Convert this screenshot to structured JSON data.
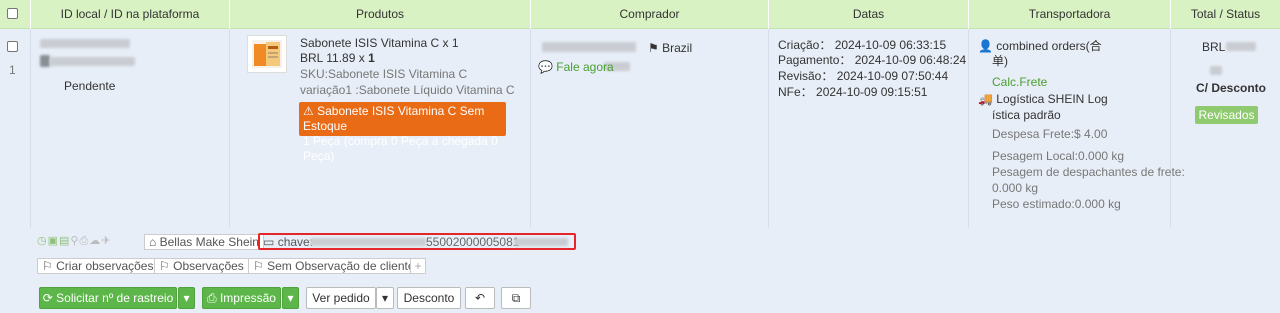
{
  "header": {
    "col_id": "ID local / ID na plataforma",
    "col_products": "Produtos",
    "col_buyer": "Comprador",
    "col_dates": "Datas",
    "col_carrier": "Transportadora",
    "col_total": "Total / Status"
  },
  "order": {
    "index": "1",
    "status": "Pendente",
    "product": {
      "title": "Sabonete ISIS Vitamina C x 1",
      "price": "BRL 11.89 x",
      "qty": "1",
      "sku": "SKU:Sabonete ISIS Vitamina C",
      "variation": "variação1 :Sabonete Líquido Vitamina C",
      "stock_warning_line1": "Sabonete ISIS Vitamina C Sem Estoque",
      "stock_warning_line2": "1 Peça (compra 0 Peça a chegada 0 Peça)"
    },
    "buyer": {
      "country": "Brazil",
      "chat": "Fale agora"
    },
    "dates": {
      "creation_label": "Criação：",
      "creation": "2024-10-09 06:33:15",
      "payment_label": "Pagamento：",
      "payment": "2024-10-09 06:48:24",
      "revision_label": "Revisão：",
      "revision": "2024-10-09 07:50:44",
      "nfe_label": "NFe：",
      "nfe": "2024-10-09 09:15:51"
    },
    "carrier": {
      "combined_line1": "combined orders(合",
      "combined_line2": "单)",
      "calc_frete": "Calc.Frete",
      "logistics_line1": "Logística SHEIN Log",
      "logistics_line2": "ística padrão",
      "despesa": "Despesa Frete:$ 4.00",
      "pesagem_local": "Pesagem Local:0.000 kg",
      "pesagem_desp_line1": "Pesagem de despachantes de frete:",
      "pesagem_desp_line2": "0.000 kg",
      "peso_estimado": "Peso estimado:0.000 kg"
    },
    "total": {
      "amount": "BRL",
      "discount": "C/ Desconto",
      "status": "Revisados"
    },
    "store": "Bellas Make Shein",
    "chave_label": "chave:",
    "chave_value": "55002000005081"
  },
  "notes": {
    "create": "Criar observações",
    "observations": "Observações",
    "no_client_note": "Sem Observação de cliente"
  },
  "actions": {
    "request_tracking": "Solicitar nº de rastreio",
    "print": "Impressão",
    "view_order": "Ver pedido",
    "discount": "Desconto"
  },
  "colors": {
    "header_bg": "#d9f2c4",
    "row_bg": "#e8eef7",
    "green": "#5db64a",
    "orange": "#ea6b16",
    "red": "#e4262b"
  }
}
